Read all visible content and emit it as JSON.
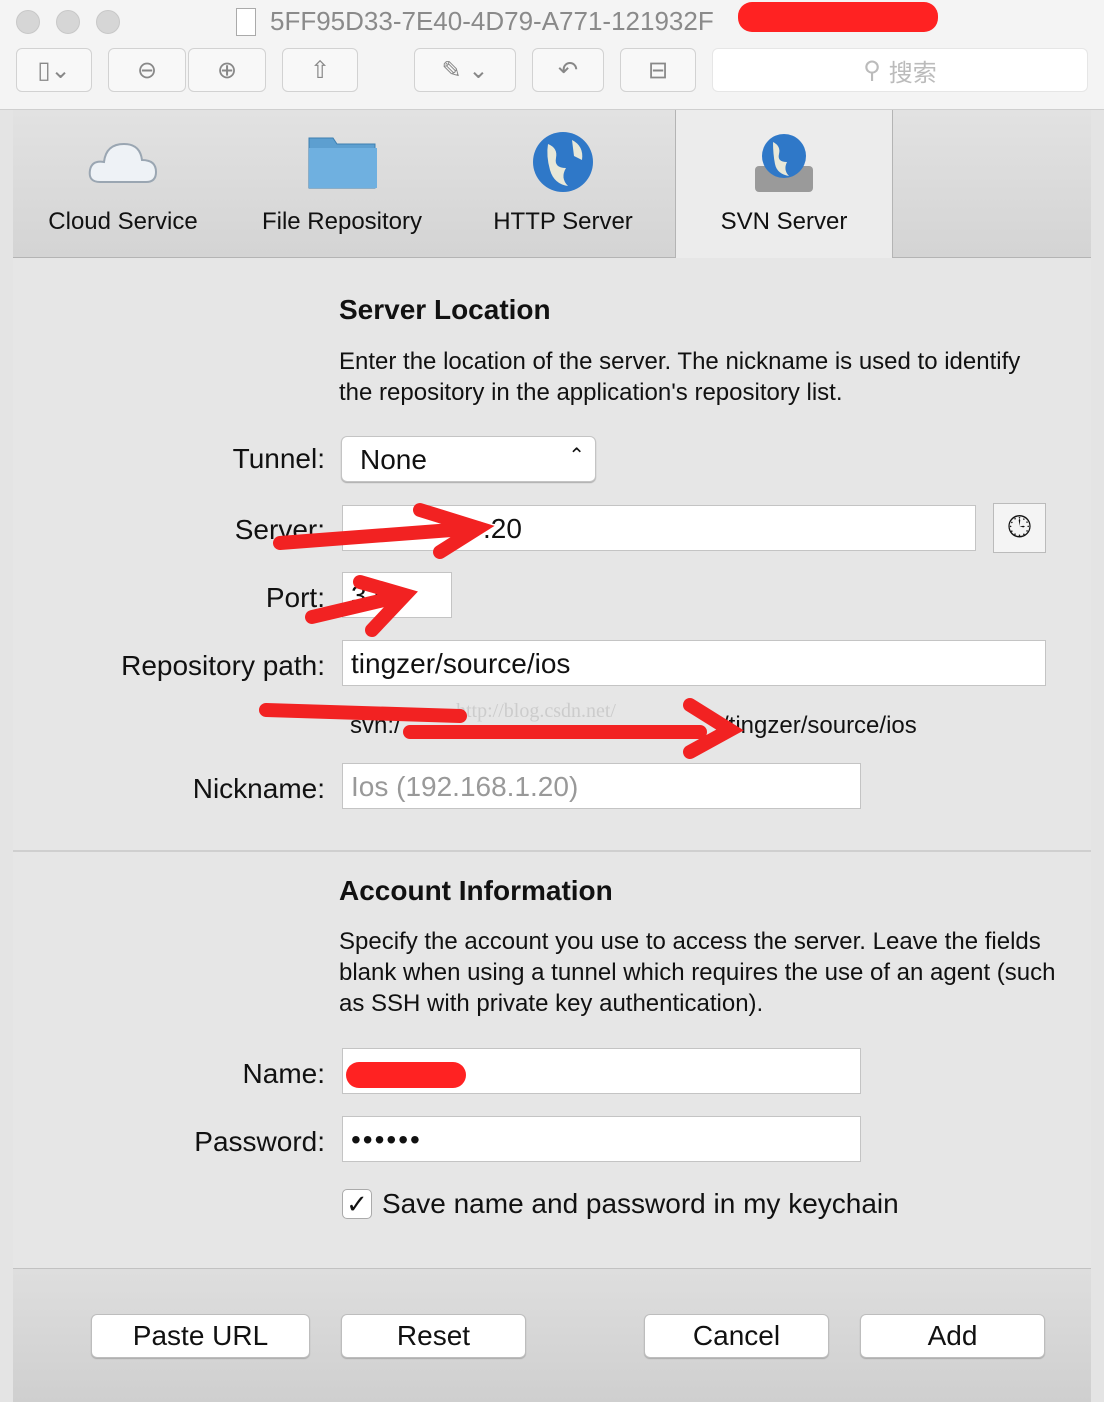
{
  "window": {
    "title": "5FF95D33-7E40-4D79-A771-121932F",
    "search_placeholder": "搜索"
  },
  "toolbar": {
    "icons": [
      "sidebar-icon",
      "zoom-out-icon",
      "zoom-in-icon",
      "share-icon",
      "markup-icon",
      "rotate-icon",
      "toolbox-icon"
    ]
  },
  "tabs": [
    {
      "label": "Cloud Service",
      "icon": "cloud-icon"
    },
    {
      "label": "File Repository",
      "icon": "folder-icon"
    },
    {
      "label": "HTTP Server",
      "icon": "globe-icon"
    },
    {
      "label": "SVN Server",
      "icon": "globe-drive-icon",
      "selected": true
    }
  ],
  "location": {
    "heading": "Server Location",
    "description": "Enter the location of the server. The nickname is used to identify the repository in the application's repository list.",
    "tunnel_label": "Tunnel:",
    "tunnel_value": "None",
    "server_label": "Server:",
    "server_value": ".20",
    "port_label": "Port:",
    "port_value": "3   0",
    "path_label": "Repository path:",
    "path_value": "tingzer/source/ios",
    "url_preview_prefix": "svn:/",
    "url_preview_suffix": "/tingzer/source/ios",
    "watermark": "http://blog.csdn.net/",
    "nickname_label": "Nickname:",
    "nickname_placeholder": "Ios (192.168.1.20)"
  },
  "account": {
    "heading": "Account Information",
    "description": "Specify the account you use to access the server. Leave the fields blank when using a tunnel which requires the use of an agent (such as SSH with private key authentication).",
    "name_label": "Name:",
    "name_value": "",
    "password_label": "Password:",
    "password_value": "••••••",
    "keychain_label": "Save name and password in my keychain",
    "keychain_checked": true
  },
  "buttons": {
    "paste_url": "Paste URL",
    "reset": "Reset",
    "cancel": "Cancel",
    "add": "Add"
  },
  "colors": {
    "annotation_red": "#f22222"
  }
}
